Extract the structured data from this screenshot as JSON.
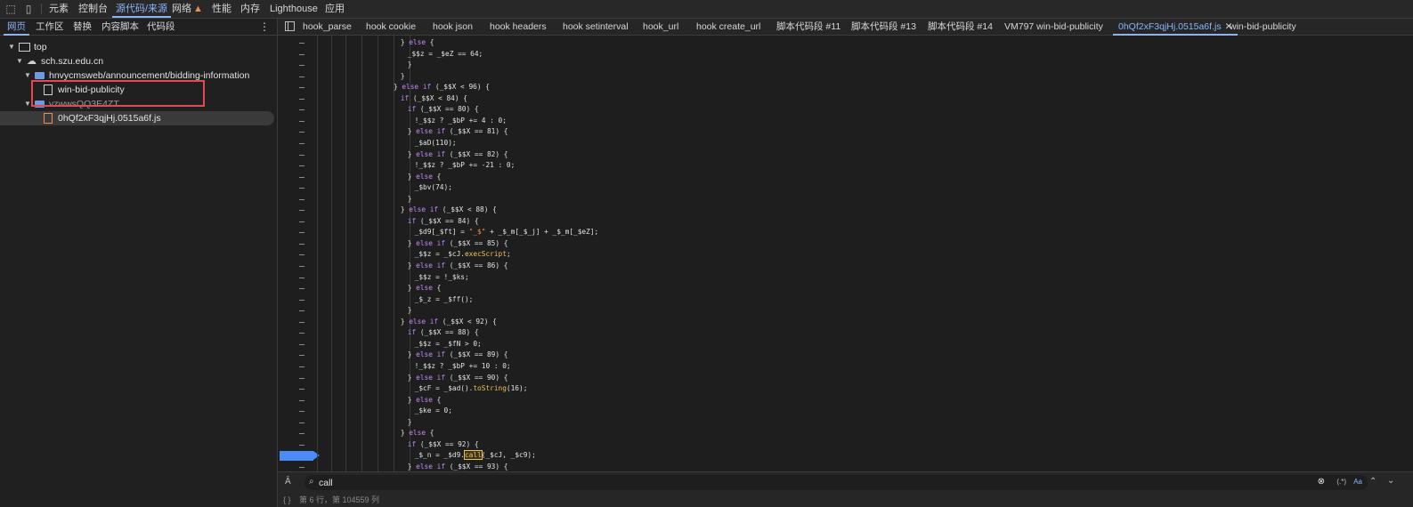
{
  "toolbar": {
    "tabs": [
      {
        "label": "元素"
      },
      {
        "label": "控制台"
      },
      {
        "label": "源代码/来源"
      },
      {
        "label": "网络"
      },
      {
        "label": "性能"
      },
      {
        "label": "内存"
      },
      {
        "label": "Lighthouse"
      },
      {
        "label": "应用"
      }
    ],
    "network_warning_icon": "warning-triangle"
  },
  "left_tabs": [
    "网页",
    "工作区",
    "替换",
    "内容脚本",
    "代码段"
  ],
  "tree": [
    {
      "label": "top",
      "icon": "frame-icon"
    },
    {
      "label": "sch.szu.edu.cn",
      "icon": "cloud-icon"
    },
    {
      "label": "hnvycmsweb/announcement/bidding-information",
      "icon": "folder-icon"
    },
    {
      "label": "win-bid-publicity",
      "icon": "file-icon"
    },
    {
      "label": "vzwwsQQ3E4ZT",
      "icon": "folder-icon"
    },
    {
      "label": "0hQf2xF3qjHj.0515a6f.js",
      "icon": "js-file-icon"
    }
  ],
  "editor_tabs": [
    {
      "label": "hook_parse"
    },
    {
      "label": "hook cookie"
    },
    {
      "label": "hook json"
    },
    {
      "label": "hook headers"
    },
    {
      "label": "hook setinterval"
    },
    {
      "label": "hook_url"
    },
    {
      "label": "hook create_url"
    },
    {
      "label": "脚本代码段 #11"
    },
    {
      "label": "脚本代码段 #13"
    },
    {
      "label": "脚本代码段 #14"
    },
    {
      "label": "VM797 win-bid-publicity"
    },
    {
      "label": "0hQf2xF3qjHj.0515a6f.js"
    },
    {
      "label": "win-bid-publicity"
    }
  ],
  "code_lines": [
    "} else {",
    "_$$z = _$eZ == 64;",
    "}",
    "}",
    "} else if (_$$X < 96) {",
    "if (_$$X < 84) {",
    "if (_$$X == 80) {",
    "!_$$z ? _$bP += 4 : 0;",
    "} else if (_$$X == 81) {",
    "_$aD(110);",
    "} else if (_$$X == 82) {",
    "!_$$z ? _$bP += -21 : 0;",
    "} else {",
    "_$bv(74);",
    "}",
    "} else if (_$$X < 88) {",
    "if (_$$X == 84) {",
    "_$d9[_$ft] = \"_$\" + _$_m[_$_j] + _$_m[_$eZ];",
    "} else if (_$$X == 85) {",
    "_$$z = _$cJ.execScript;",
    "} else if (_$$X == 86) {",
    "_$$z = !_$ks;",
    "} else {",
    "_$_z = _$ff();",
    "}",
    "} else if (_$$X < 92) {",
    "if (_$$X == 88) {",
    "_$$z = _$fN > 0;",
    "} else if (_$$X == 89) {",
    "!_$$z ? _$bP += 10 : 0;",
    "} else if (_$$X == 90) {",
    "_$cF = _$ad().toString(16);",
    "} else {",
    "_$ke = 0;",
    "}",
    "} else {",
    "if (_$$X == 92) {",
    "_$_n = _$d9.call(_$cJ, _$c9);",
    "} else if (_$$X == 93) {"
  ],
  "search": {
    "value": "call",
    "regex_label": "(.*)",
    "case_label": "Aa"
  },
  "status": {
    "text": "第 6 行，第 104559 列"
  }
}
